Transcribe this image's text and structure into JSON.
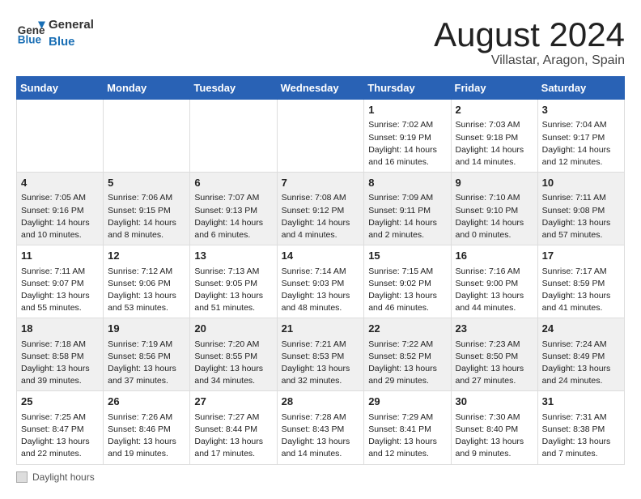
{
  "header": {
    "logo_general": "General",
    "logo_blue": "Blue",
    "month_year": "August 2024",
    "location": "Villastar, Aragon, Spain"
  },
  "days_of_week": [
    "Sunday",
    "Monday",
    "Tuesday",
    "Wednesday",
    "Thursday",
    "Friday",
    "Saturday"
  ],
  "weeks": [
    [
      {
        "day": "",
        "info": ""
      },
      {
        "day": "",
        "info": ""
      },
      {
        "day": "",
        "info": ""
      },
      {
        "day": "",
        "info": ""
      },
      {
        "day": "1",
        "info": "Sunrise: 7:02 AM\nSunset: 9:19 PM\nDaylight: 14 hours and 16 minutes."
      },
      {
        "day": "2",
        "info": "Sunrise: 7:03 AM\nSunset: 9:18 PM\nDaylight: 14 hours and 14 minutes."
      },
      {
        "day": "3",
        "info": "Sunrise: 7:04 AM\nSunset: 9:17 PM\nDaylight: 14 hours and 12 minutes."
      }
    ],
    [
      {
        "day": "4",
        "info": "Sunrise: 7:05 AM\nSunset: 9:16 PM\nDaylight: 14 hours and 10 minutes."
      },
      {
        "day": "5",
        "info": "Sunrise: 7:06 AM\nSunset: 9:15 PM\nDaylight: 14 hours and 8 minutes."
      },
      {
        "day": "6",
        "info": "Sunrise: 7:07 AM\nSunset: 9:13 PM\nDaylight: 14 hours and 6 minutes."
      },
      {
        "day": "7",
        "info": "Sunrise: 7:08 AM\nSunset: 9:12 PM\nDaylight: 14 hours and 4 minutes."
      },
      {
        "day": "8",
        "info": "Sunrise: 7:09 AM\nSunset: 9:11 PM\nDaylight: 14 hours and 2 minutes."
      },
      {
        "day": "9",
        "info": "Sunrise: 7:10 AM\nSunset: 9:10 PM\nDaylight: 14 hours and 0 minutes."
      },
      {
        "day": "10",
        "info": "Sunrise: 7:11 AM\nSunset: 9:08 PM\nDaylight: 13 hours and 57 minutes."
      }
    ],
    [
      {
        "day": "11",
        "info": "Sunrise: 7:11 AM\nSunset: 9:07 PM\nDaylight: 13 hours and 55 minutes."
      },
      {
        "day": "12",
        "info": "Sunrise: 7:12 AM\nSunset: 9:06 PM\nDaylight: 13 hours and 53 minutes."
      },
      {
        "day": "13",
        "info": "Sunrise: 7:13 AM\nSunset: 9:05 PM\nDaylight: 13 hours and 51 minutes."
      },
      {
        "day": "14",
        "info": "Sunrise: 7:14 AM\nSunset: 9:03 PM\nDaylight: 13 hours and 48 minutes."
      },
      {
        "day": "15",
        "info": "Sunrise: 7:15 AM\nSunset: 9:02 PM\nDaylight: 13 hours and 46 minutes."
      },
      {
        "day": "16",
        "info": "Sunrise: 7:16 AM\nSunset: 9:00 PM\nDaylight: 13 hours and 44 minutes."
      },
      {
        "day": "17",
        "info": "Sunrise: 7:17 AM\nSunset: 8:59 PM\nDaylight: 13 hours and 41 minutes."
      }
    ],
    [
      {
        "day": "18",
        "info": "Sunrise: 7:18 AM\nSunset: 8:58 PM\nDaylight: 13 hours and 39 minutes."
      },
      {
        "day": "19",
        "info": "Sunrise: 7:19 AM\nSunset: 8:56 PM\nDaylight: 13 hours and 37 minutes."
      },
      {
        "day": "20",
        "info": "Sunrise: 7:20 AM\nSunset: 8:55 PM\nDaylight: 13 hours and 34 minutes."
      },
      {
        "day": "21",
        "info": "Sunrise: 7:21 AM\nSunset: 8:53 PM\nDaylight: 13 hours and 32 minutes."
      },
      {
        "day": "22",
        "info": "Sunrise: 7:22 AM\nSunset: 8:52 PM\nDaylight: 13 hours and 29 minutes."
      },
      {
        "day": "23",
        "info": "Sunrise: 7:23 AM\nSunset: 8:50 PM\nDaylight: 13 hours and 27 minutes."
      },
      {
        "day": "24",
        "info": "Sunrise: 7:24 AM\nSunset: 8:49 PM\nDaylight: 13 hours and 24 minutes."
      }
    ],
    [
      {
        "day": "25",
        "info": "Sunrise: 7:25 AM\nSunset: 8:47 PM\nDaylight: 13 hours and 22 minutes."
      },
      {
        "day": "26",
        "info": "Sunrise: 7:26 AM\nSunset: 8:46 PM\nDaylight: 13 hours and 19 minutes."
      },
      {
        "day": "27",
        "info": "Sunrise: 7:27 AM\nSunset: 8:44 PM\nDaylight: 13 hours and 17 minutes."
      },
      {
        "day": "28",
        "info": "Sunrise: 7:28 AM\nSunset: 8:43 PM\nDaylight: 13 hours and 14 minutes."
      },
      {
        "day": "29",
        "info": "Sunrise: 7:29 AM\nSunset: 8:41 PM\nDaylight: 13 hours and 12 minutes."
      },
      {
        "day": "30",
        "info": "Sunrise: 7:30 AM\nSunset: 8:40 PM\nDaylight: 13 hours and 9 minutes."
      },
      {
        "day": "31",
        "info": "Sunrise: 7:31 AM\nSunset: 8:38 PM\nDaylight: 13 hours and 7 minutes."
      }
    ]
  ],
  "footer": {
    "daylight_label": "Daylight hours"
  }
}
